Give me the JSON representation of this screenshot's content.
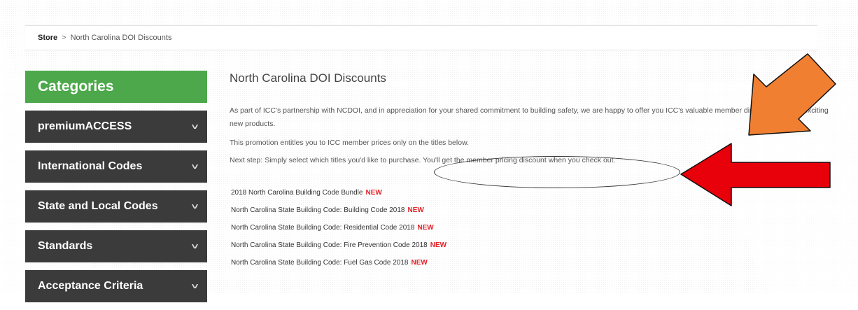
{
  "breadcrumb": {
    "store": "Store",
    "separator": ">",
    "current": "North Carolina DOI Discounts"
  },
  "sidebar": {
    "header": "Categories",
    "items": [
      {
        "label": "premiumACCESS"
      },
      {
        "label": "International Codes"
      },
      {
        "label": "State and Local Codes"
      },
      {
        "label": "Standards"
      },
      {
        "label": "Acceptance Criteria"
      }
    ]
  },
  "main": {
    "title": "North Carolina DOI Discounts",
    "paragraphs": [
      "As part of ICC's partnership with NCDOI, and in appreciation for your shared commitment to building safety, we are happy to offer you ICC's valuable member discount on these exciting new products.",
      "This promotion entitles you to ICC member prices only on the titles below.",
      "Next step: Simply select which titles you'd like to purchase. You'll get the member pricing discount when you check out."
    ],
    "new_badge": "NEW",
    "products": [
      "2018 North Carolina Building Code Bundle",
      "North Carolina State Building Code: Building Code 2018",
      "North Carolina State Building Code: Residential Code 2018",
      "North Carolina State Building Code: Fire Prevention Code 2018",
      "North Carolina State Building Code: Fuel Gas Code 2018"
    ]
  },
  "colors": {
    "category_header": "#4ca84a",
    "category_item": "#3b3b3b",
    "new_badge": "#e2232a",
    "orange_arrow": "#f07f32",
    "red_arrow": "#e8000b"
  }
}
